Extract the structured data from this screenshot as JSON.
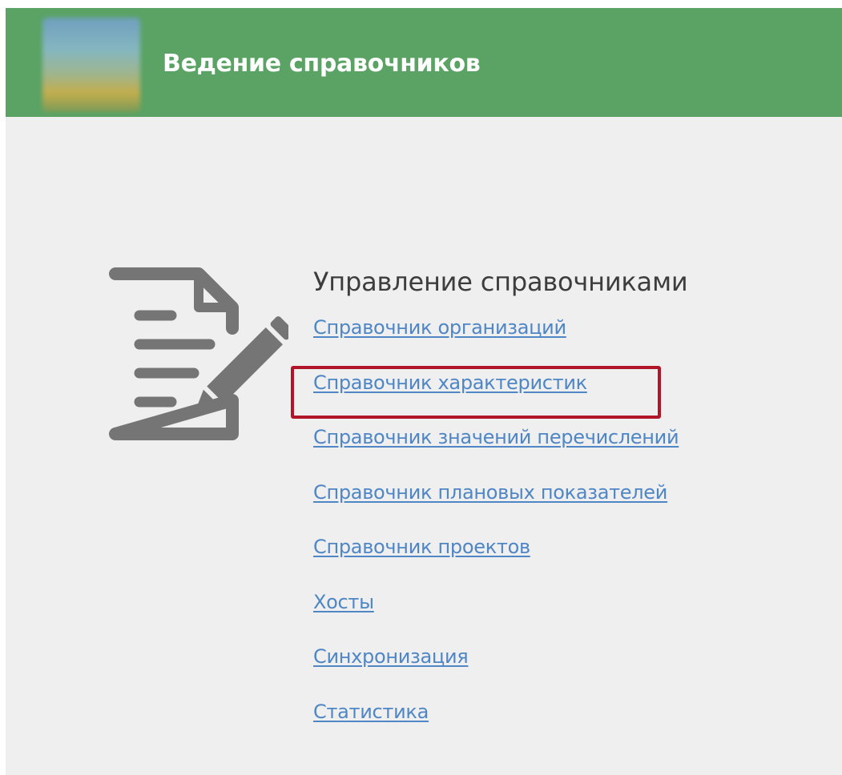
{
  "header": {
    "title": "Ведение справочников",
    "logo_icon": "app-logo",
    "background_color": "#5aa364"
  },
  "main": {
    "icon": "document-edit-icon",
    "section_title": "Управление справочниками",
    "links": [
      {
        "label": "Справочник организаций"
      },
      {
        "label": "Справочник характеристик",
        "highlighted": true
      },
      {
        "label": "Справочник значений перечислений"
      },
      {
        "label": "Справочник плановых показателей"
      },
      {
        "label": "Справочник проектов"
      },
      {
        "label": "Хосты"
      },
      {
        "label": "Синхронизация"
      },
      {
        "label": "Статистика"
      }
    ],
    "link_color": "#4f86c6",
    "highlight_color": "#b0152a"
  }
}
